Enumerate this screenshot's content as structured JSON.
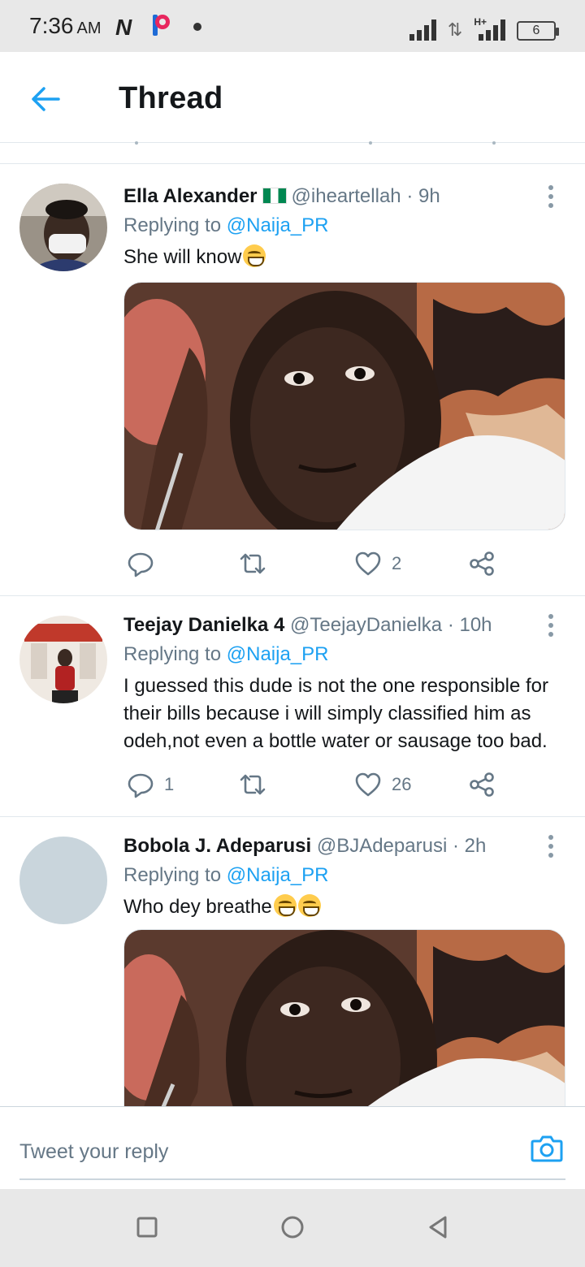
{
  "status_bar": {
    "time": "7:36",
    "ampm": "AM",
    "network_label": "H+",
    "battery": "6"
  },
  "header": {
    "title": "Thread"
  },
  "tweets": [
    {
      "name": "Ella Alexander",
      "handle": "@iheartellah",
      "separator": "·",
      "time": "9h",
      "replying_prefix": "Replying to",
      "replying_to": "@Naija_PR",
      "text": "She will know",
      "emoji": "face-with-tears-of-joy",
      "has_media": true,
      "reply_count": "",
      "retweet_count": "",
      "like_count": "2"
    },
    {
      "name": "Teejay Danielka 4",
      "handle": "@TeejayDanielka",
      "separator": "·",
      "time": "10h",
      "replying_prefix": "Replying to",
      "replying_to": "@Naija_PR",
      "text": "I guessed this dude is not the one responsible for their bills because i will simply classified him as odeh,not even a bottle water or sausage too bad.",
      "has_media": false,
      "reply_count": "1",
      "retweet_count": "",
      "like_count": "26"
    },
    {
      "name": "Bobola J. Adeparusi",
      "handle": "@BJAdeparusi",
      "separator": "·",
      "time": "2h",
      "replying_prefix": "Replying to",
      "replying_to": "@Naija_PR",
      "text": "Who dey breathe",
      "emoji": "grinning-face",
      "has_media": true
    }
  ],
  "reply_bar": {
    "placeholder": "Tweet your reply"
  },
  "icons": {
    "back": "arrow-left-icon",
    "more": "more-vertical-icon",
    "reply": "reply-icon",
    "retweet": "retweet-icon",
    "like": "heart-icon",
    "share": "share-icon",
    "camera": "camera-icon"
  },
  "colors": {
    "accent": "#1da1f2",
    "secondary_text": "#657786",
    "divider": "#e1e8ed"
  }
}
